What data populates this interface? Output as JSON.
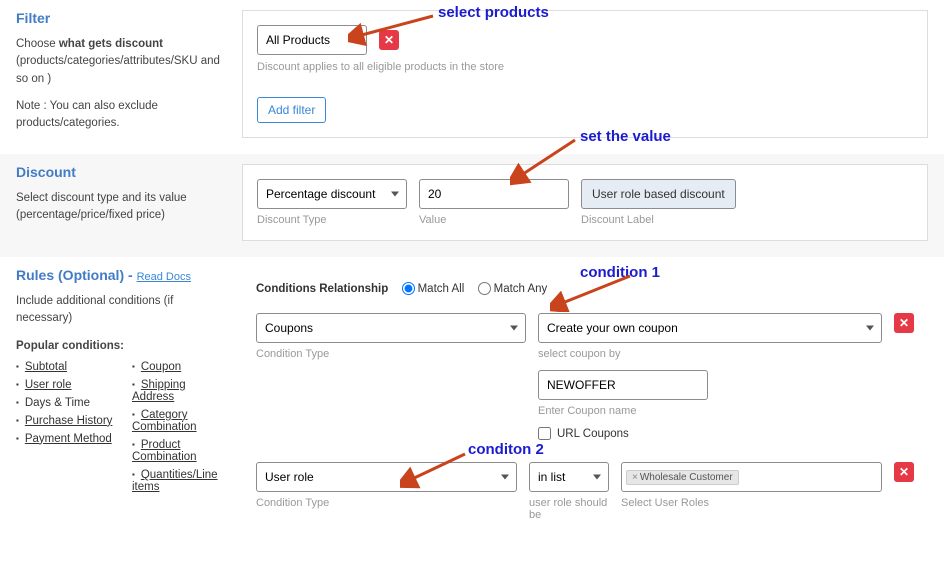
{
  "filter": {
    "title": "Filter",
    "choose_prefix": "Choose ",
    "choose_strong": "what gets discount",
    "choose_suffix": " (products/categories/attributes/SKU and so on )",
    "note": "Note : You can also exclude products/categories.",
    "select_value": "All Products",
    "helper": "Discount applies to all eligible products in the store",
    "add_filter_btn": "Add filter"
  },
  "discount": {
    "title": "Discount",
    "desc": "Select discount type and its value (percentage/price/fixed price)",
    "type_value": "Percentage discount",
    "type_label": "Discount Type",
    "value_input": "20",
    "value_label": "Value",
    "label_btn": "User role based discount",
    "label_label": "Discount Label"
  },
  "rules": {
    "title_main": "Rules (Optional)",
    "title_sep": " - ",
    "read_docs": "Read Docs",
    "desc": "Include additional conditions (if necessary)",
    "pop_heading": "Popular conditions:",
    "col1": [
      "Subtotal",
      "User role",
      "Days & Time",
      "Purchase History",
      "Payment Method"
    ],
    "col2": [
      "Coupon",
      "Shipping Address",
      "Category Combination",
      "Product Combination",
      "Quantities/Line items"
    ],
    "rel_label": "Conditions Relationship",
    "match_all": "Match All",
    "match_any": "Match Any",
    "cond1": {
      "type_value": "Coupons",
      "type_label": "Condition Type",
      "coupon_mode": "Create your own coupon",
      "coupon_mode_label": "select coupon by",
      "coupon_val": "NEWOFFER",
      "coupon_val_label": "Enter Coupon name",
      "url_coupons": "URL Coupons"
    },
    "cond2": {
      "type_value": "User role",
      "type_label": "Condition Type",
      "in_list": "in list",
      "in_list_label": "user role should be",
      "tag": "Wholesale Customer",
      "roles_label": "Select User Roles"
    }
  },
  "annotations": {
    "a1": "select products",
    "a2": "set the value",
    "a3": "condition 1",
    "a4": "conditon 2"
  }
}
